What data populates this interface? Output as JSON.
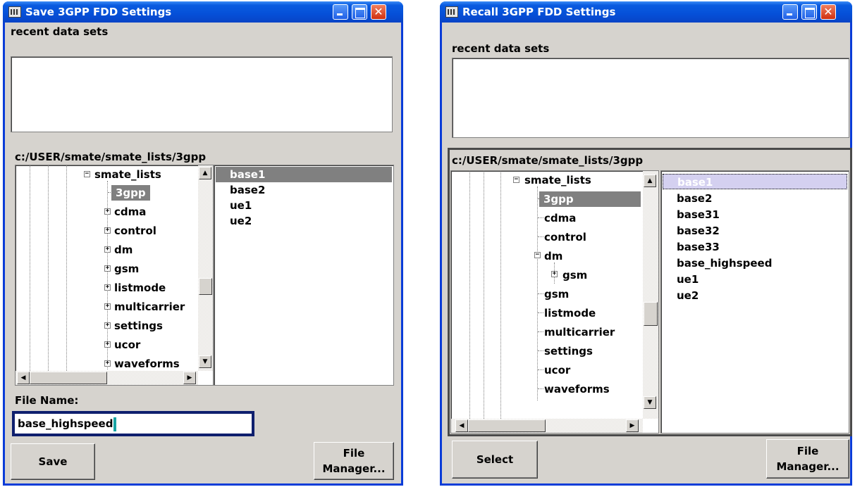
{
  "save_dialog": {
    "title": "Save 3GPP FDD Settings",
    "recent_label": "recent data sets",
    "path": "c:/USER/smate/smate_lists/3gpp",
    "tree": [
      {
        "label": "smate_lists",
        "expander": "−"
      },
      {
        "label": "3gpp",
        "selected": true
      },
      {
        "label": "cdma",
        "expander": "+"
      },
      {
        "label": "control",
        "expander": "+"
      },
      {
        "label": "dm",
        "expander": "+"
      },
      {
        "label": "gsm",
        "expander": "+"
      },
      {
        "label": "listmode",
        "expander": "+"
      },
      {
        "label": "multicarrier",
        "expander": "+"
      },
      {
        "label": "settings",
        "expander": "+"
      },
      {
        "label": "ucor",
        "expander": "+"
      },
      {
        "label": "waveforms",
        "expander": "+"
      }
    ],
    "files": [
      "base1",
      "base2",
      "ue1",
      "ue2"
    ],
    "file_name_label": "File Name:",
    "file_name_value": "base_highspeed",
    "save_button": "Save",
    "file_manager_button_line1": "File",
    "file_manager_button_line2": "Manager..."
  },
  "recall_dialog": {
    "title": "Recall 3GPP FDD Settings",
    "recent_label": "recent data sets",
    "path": "c:/USER/smate/smate_lists/3gpp",
    "tree": [
      {
        "label": "smate_lists",
        "expander": "−"
      },
      {
        "label": "3gpp",
        "selected": true
      },
      {
        "label": "cdma"
      },
      {
        "label": "control"
      },
      {
        "label": "dm",
        "expander": "−"
      },
      {
        "label": "gsm",
        "expander": "+"
      },
      {
        "label": "gsm"
      },
      {
        "label": "listmode"
      },
      {
        "label": "multicarrier"
      },
      {
        "label": "settings"
      },
      {
        "label": "ucor"
      },
      {
        "label": "waveforms"
      }
    ],
    "files": [
      "base1",
      "base2",
      "base31",
      "base32",
      "base33",
      "base_highspeed",
      "ue1",
      "ue2"
    ],
    "select_button": "Select",
    "file_manager_button_line1": "File",
    "file_manager_button_line2": "Manager..."
  },
  "title_buttons": {
    "minimize": "minimize-icon",
    "maximize": "maximize-icon",
    "close": "close-icon",
    "close_glyph": "✕"
  },
  "colors": {
    "titlebar": "#0550d8",
    "dialog_bg": "#d6d3ce",
    "selection": "#808080",
    "input_border": "#0f1f6e",
    "caret": "#18a4a4"
  }
}
